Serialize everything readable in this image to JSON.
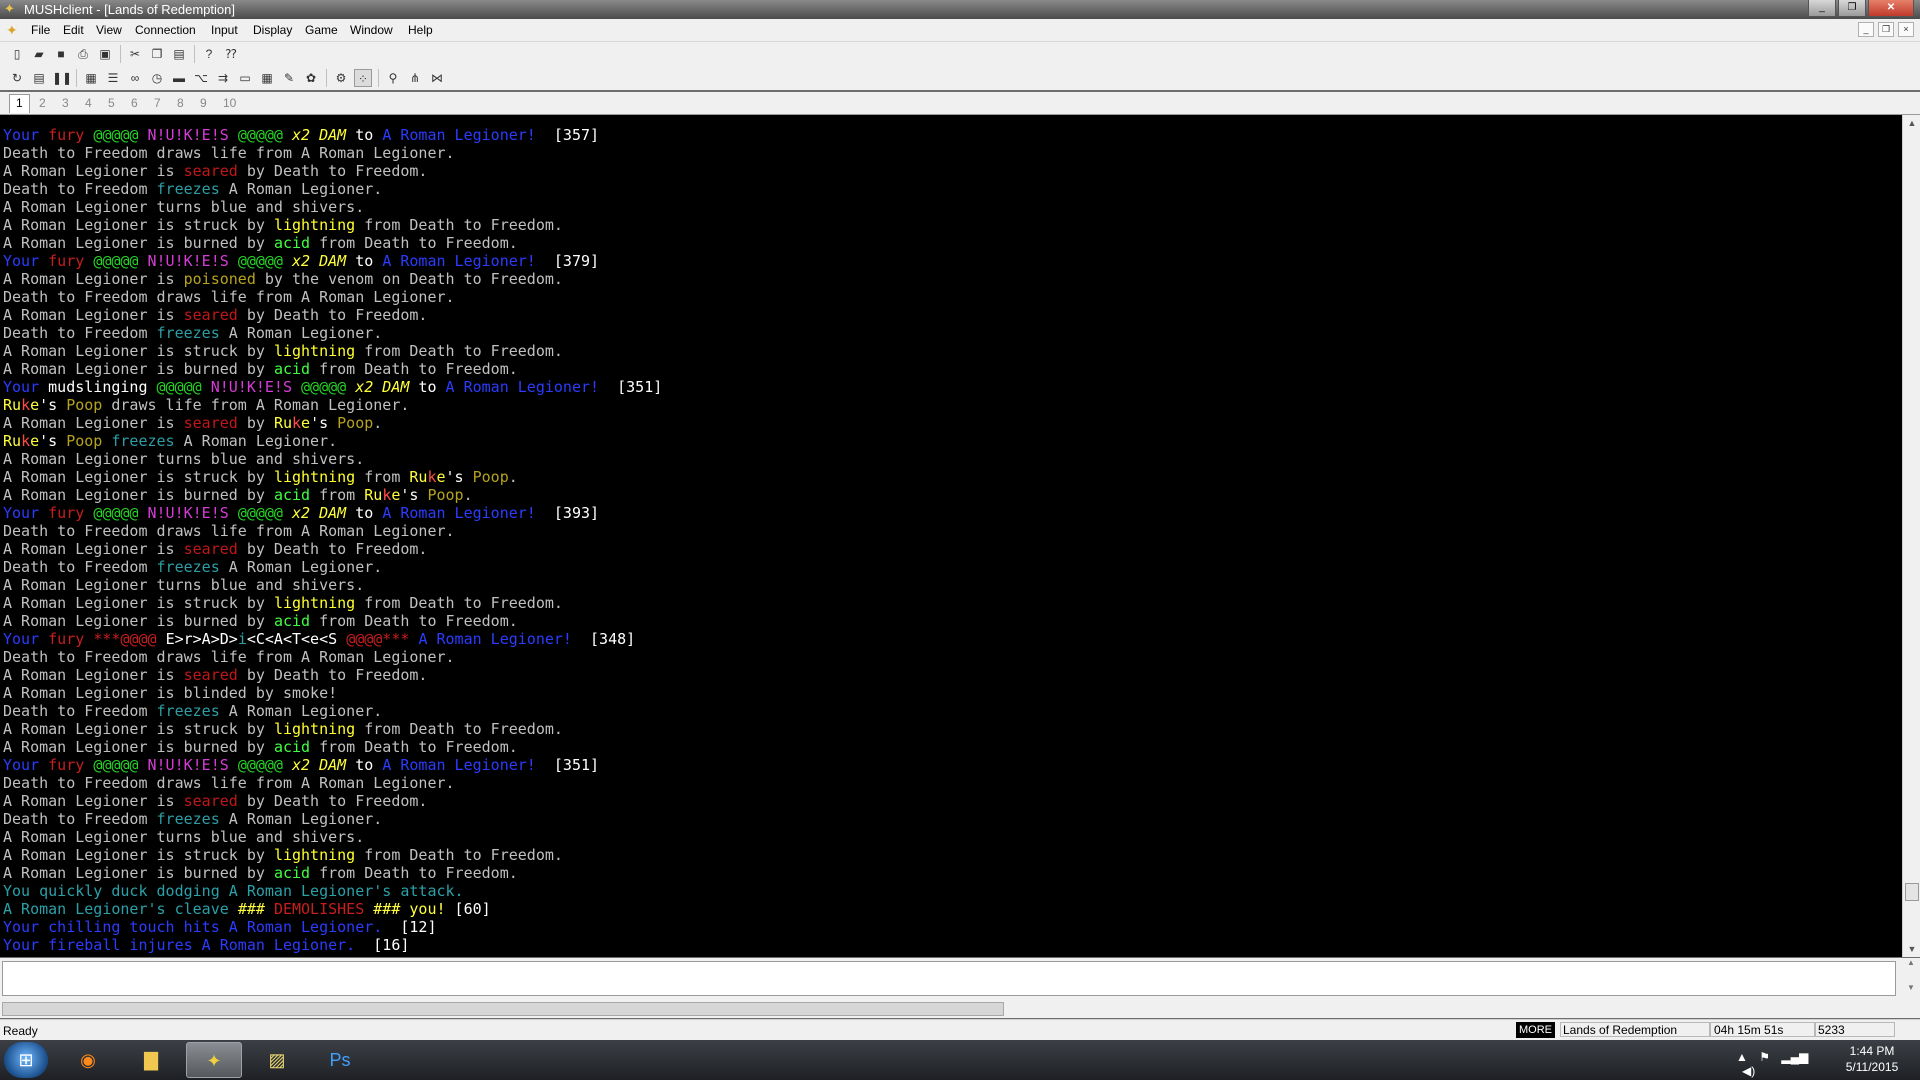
{
  "window": {
    "title": "MUSHclient - [Lands of Redemption]",
    "controls": [
      "_",
      "❐",
      "✕"
    ],
    "mdi_controls": [
      "_",
      "❐",
      "×"
    ]
  },
  "menu": [
    "File",
    "Edit",
    "View",
    "Connection",
    "Input",
    "Display",
    "Game",
    "Window",
    "Help"
  ],
  "toolbar1": [
    {
      "name": "new-icon",
      "glyph": "▯"
    },
    {
      "name": "open-icon",
      "glyph": "▰"
    },
    {
      "name": "save-icon",
      "glyph": "■"
    },
    {
      "name": "print-icon",
      "glyph": "⎙"
    },
    {
      "name": "print-preview-icon",
      "glyph": "▣"
    },
    {
      "name": "cut-icon",
      "glyph": "✂"
    },
    {
      "name": "copy-icon",
      "glyph": "❐"
    },
    {
      "name": "paste-icon",
      "glyph": "▤"
    },
    {
      "name": "help-icon",
      "glyph": "?"
    },
    {
      "name": "context-help-icon",
      "glyph": "⁇"
    }
  ],
  "toolbar2": [
    {
      "name": "reconnect-icon",
      "glyph": "↻"
    },
    {
      "name": "log-icon",
      "glyph": "▤"
    },
    {
      "name": "pause-icon",
      "glyph": "❚❚"
    },
    {
      "name": "world-config-icon",
      "glyph": "▦"
    },
    {
      "name": "list-icon",
      "glyph": "☰"
    },
    {
      "name": "macro-icon",
      "glyph": "∞"
    },
    {
      "name": "timer-icon",
      "glyph": "◷"
    },
    {
      "name": "screen-icon",
      "glyph": "▬"
    },
    {
      "name": "trigger-icon",
      "glyph": "⌥"
    },
    {
      "name": "alias-icon",
      "glyph": "⇉"
    },
    {
      "name": "window-icon",
      "glyph": "▭"
    },
    {
      "name": "table-icon",
      "glyph": "▦"
    },
    {
      "name": "notepad-icon",
      "glyph": "✎"
    },
    {
      "name": "scripts-icon",
      "glyph": "✿"
    },
    {
      "name": "plugins-icon",
      "glyph": "⚙"
    },
    {
      "name": "speedwalk-icon",
      "glyph": "⁘"
    },
    {
      "name": "find-icon",
      "glyph": "⚲"
    },
    {
      "name": "mapper-icon",
      "glyph": "⋔"
    },
    {
      "name": "chat-icon",
      "glyph": "⋈"
    }
  ],
  "world_tabs": [
    "1",
    "2",
    "3",
    "4",
    "5",
    "6",
    "7",
    "8",
    "9",
    "10"
  ],
  "colors": {
    "gray": "#c0c0c0",
    "blue": "#2b3cff",
    "red": "#c81e1e",
    "green": "#26d426",
    "magenta": "#d63cd6",
    "yellow": "#ffff3c",
    "cyan": "#2aa0a8",
    "lightred": "#ff4a4a",
    "olive": "#b5a31c",
    "white": "#ffffff",
    "acid": "#40ff40",
    "lightning": "#ffff30",
    "seared": "#c01818",
    "freeze": "#2e9ea6"
  },
  "output_lines": [
    [
      [
        "Your ",
        "blue"
      ],
      [
        "fury ",
        "red"
      ],
      [
        "@@@@@ ",
        "green"
      ],
      [
        "N!U!K!E!S ",
        "magenta"
      ],
      [
        "@@@@@ ",
        "green"
      ],
      [
        "x2 DAM ",
        "yellow"
      ],
      [
        "to ",
        "white"
      ],
      [
        "A Roman Legioner!",
        "blue"
      ],
      [
        "  [357]",
        "white"
      ]
    ],
    [
      [
        "Death to Freedom draws life from A Roman Legioner.",
        "gray"
      ]
    ],
    [
      [
        "A Roman Legioner is ",
        "gray"
      ],
      [
        "seared",
        "seared"
      ],
      [
        " by Death to Freedom.",
        "gray"
      ]
    ],
    [
      [
        "Death to Freedom ",
        "gray"
      ],
      [
        "freezes",
        "freeze"
      ],
      [
        " A Roman Legioner.",
        "gray"
      ]
    ],
    [
      [
        "A Roman Legioner turns blue and shivers.",
        "gray"
      ]
    ],
    [
      [
        "A Roman Legioner is struck by ",
        "gray"
      ],
      [
        "lightning",
        "lightning"
      ],
      [
        " from Death to Freedom.",
        "gray"
      ]
    ],
    [
      [
        "A Roman Legioner is burned by ",
        "gray"
      ],
      [
        "acid",
        "acid"
      ],
      [
        " from Death to Freedom.",
        "gray"
      ]
    ],
    [
      [
        "Your ",
        "blue"
      ],
      [
        "fury ",
        "red"
      ],
      [
        "@@@@@ ",
        "green"
      ],
      [
        "N!U!K!E!S ",
        "magenta"
      ],
      [
        "@@@@@ ",
        "green"
      ],
      [
        "x2 DAM ",
        "yellow"
      ],
      [
        "to ",
        "white"
      ],
      [
        "A Roman Legioner!",
        "blue"
      ],
      [
        "  [379]",
        "white"
      ]
    ],
    [
      [
        "A Roman Legioner is ",
        "gray"
      ],
      [
        "poisoned",
        "olive"
      ],
      [
        " by the venom on Death to Freedom.",
        "gray"
      ]
    ],
    [
      [
        "Death to Freedom draws life from A Roman Legioner.",
        "gray"
      ]
    ],
    [
      [
        "A Roman Legioner is ",
        "gray"
      ],
      [
        "seared",
        "seared"
      ],
      [
        " by Death to Freedom.",
        "gray"
      ]
    ],
    [
      [
        "Death to Freedom ",
        "gray"
      ],
      [
        "freezes",
        "freeze"
      ],
      [
        " A Roman Legioner.",
        "gray"
      ]
    ],
    [
      [
        "A Roman Legioner is struck by ",
        "gray"
      ],
      [
        "lightning",
        "lightning"
      ],
      [
        " from Death to Freedom.",
        "gray"
      ]
    ],
    [
      [
        "A Roman Legioner is burned by ",
        "gray"
      ],
      [
        "acid",
        "acid"
      ],
      [
        " from Death to Freedom.",
        "gray"
      ]
    ],
    [
      [
        "Your ",
        "blue"
      ],
      [
        "mudslinging ",
        "white"
      ],
      [
        "@@@@@ ",
        "green"
      ],
      [
        "N!U!K!E!S ",
        "magenta"
      ],
      [
        "@@@@@ ",
        "green"
      ],
      [
        "x2 DAM ",
        "yellow"
      ],
      [
        "to ",
        "white"
      ],
      [
        "A Roman Legioner!",
        "blue"
      ],
      [
        "  [351]",
        "white"
      ]
    ],
    [
      [
        "Ru",
        "yellow"
      ],
      [
        "k",
        "lightred"
      ],
      [
        "e",
        "yellow"
      ],
      [
        "'s ",
        "white"
      ],
      [
        "Poop",
        "olive"
      ],
      [
        " draws life from A Roman Legioner.",
        "gray"
      ]
    ],
    [
      [
        "A Roman Legioner is ",
        "gray"
      ],
      [
        "seared",
        "seared"
      ],
      [
        " by ",
        "gray"
      ],
      [
        "Ru",
        "yellow"
      ],
      [
        "k",
        "lightred"
      ],
      [
        "e",
        "yellow"
      ],
      [
        "'s ",
        "white"
      ],
      [
        "Poop",
        "olive"
      ],
      [
        ".",
        "gray"
      ]
    ],
    [
      [
        "Ru",
        "yellow"
      ],
      [
        "k",
        "lightred"
      ],
      [
        "e",
        "yellow"
      ],
      [
        "'s ",
        "white"
      ],
      [
        "Poop ",
        "olive"
      ],
      [
        "freezes",
        "freeze"
      ],
      [
        " A Roman Legioner.",
        "gray"
      ]
    ],
    [
      [
        "A Roman Legioner turns blue and shivers.",
        "gray"
      ]
    ],
    [
      [
        "A Roman Legioner is struck by ",
        "gray"
      ],
      [
        "lightning",
        "lightning"
      ],
      [
        " from ",
        "gray"
      ],
      [
        "Ru",
        "yellow"
      ],
      [
        "k",
        "lightred"
      ],
      [
        "e",
        "yellow"
      ],
      [
        "'s ",
        "white"
      ],
      [
        "Poop",
        "olive"
      ],
      [
        ".",
        "gray"
      ]
    ],
    [
      [
        "A Roman Legioner is burned by ",
        "gray"
      ],
      [
        "acid",
        "acid"
      ],
      [
        " from ",
        "gray"
      ],
      [
        "Ru",
        "yellow"
      ],
      [
        "k",
        "lightred"
      ],
      [
        "e",
        "yellow"
      ],
      [
        "'s ",
        "white"
      ],
      [
        "Poop",
        "olive"
      ],
      [
        ".",
        "gray"
      ]
    ],
    [
      [
        "Your ",
        "blue"
      ],
      [
        "fury ",
        "red"
      ],
      [
        "@@@@@ ",
        "green"
      ],
      [
        "N!U!K!E!S ",
        "magenta"
      ],
      [
        "@@@@@ ",
        "green"
      ],
      [
        "x2 DAM ",
        "yellow"
      ],
      [
        "to ",
        "white"
      ],
      [
        "A Roman Legioner!",
        "blue"
      ],
      [
        "  [393]",
        "white"
      ]
    ],
    [
      [
        "Death to Freedom draws life from A Roman Legioner.",
        "gray"
      ]
    ],
    [
      [
        "A Roman Legioner is ",
        "gray"
      ],
      [
        "seared",
        "seared"
      ],
      [
        " by Death to Freedom.",
        "gray"
      ]
    ],
    [
      [
        "Death to Freedom ",
        "gray"
      ],
      [
        "freezes",
        "freeze"
      ],
      [
        " A Roman Legioner.",
        "gray"
      ]
    ],
    [
      [
        "A Roman Legioner turns blue and shivers.",
        "gray"
      ]
    ],
    [
      [
        "A Roman Legioner is struck by ",
        "gray"
      ],
      [
        "lightning",
        "lightning"
      ],
      [
        " from Death to Freedom.",
        "gray"
      ]
    ],
    [
      [
        "A Roman Legioner is burned by ",
        "gray"
      ],
      [
        "acid",
        "acid"
      ],
      [
        " from Death to Freedom.",
        "gray"
      ]
    ],
    [
      [
        "Your ",
        "blue"
      ],
      [
        "fury ",
        "red"
      ],
      [
        "***@@@@ ",
        "red"
      ],
      [
        "E>r>A>D>",
        "white"
      ],
      [
        "i",
        "cyan"
      ],
      [
        "<C<A<T<e<S ",
        "white"
      ],
      [
        "@@@@*** ",
        "red"
      ],
      [
        "A Roman Legioner!",
        "blue"
      ],
      [
        "  [348]",
        "white"
      ]
    ],
    [
      [
        "Death to Freedom draws life from A Roman Legioner.",
        "gray"
      ]
    ],
    [
      [
        "A Roman Legioner is ",
        "gray"
      ],
      [
        "seared",
        "seared"
      ],
      [
        " by Death to Freedom.",
        "gray"
      ]
    ],
    [
      [
        "A Roman Legioner is blinded by smoke!",
        "gray"
      ]
    ],
    [
      [
        "Death to Freedom ",
        "gray"
      ],
      [
        "freezes",
        "freeze"
      ],
      [
        " A Roman Legioner.",
        "gray"
      ]
    ],
    [
      [
        "A Roman Legioner is struck by ",
        "gray"
      ],
      [
        "lightning",
        "lightning"
      ],
      [
        " from Death to Freedom.",
        "gray"
      ]
    ],
    [
      [
        "A Roman Legioner is burned by ",
        "gray"
      ],
      [
        "acid",
        "acid"
      ],
      [
        " from Death to Freedom.",
        "gray"
      ]
    ],
    [
      [
        "Your ",
        "blue"
      ],
      [
        "fury ",
        "red"
      ],
      [
        "@@@@@ ",
        "green"
      ],
      [
        "N!U!K!E!S ",
        "magenta"
      ],
      [
        "@@@@@ ",
        "green"
      ],
      [
        "x2 DAM ",
        "yellow"
      ],
      [
        "to ",
        "white"
      ],
      [
        "A Roman Legioner!",
        "blue"
      ],
      [
        "  [351]",
        "white"
      ]
    ],
    [
      [
        "Death to Freedom draws life from A Roman Legioner.",
        "gray"
      ]
    ],
    [
      [
        "A Roman Legioner is ",
        "gray"
      ],
      [
        "seared",
        "seared"
      ],
      [
        " by Death to Freedom.",
        "gray"
      ]
    ],
    [
      [
        "Death to Freedom ",
        "gray"
      ],
      [
        "freezes",
        "freeze"
      ],
      [
        " A Roman Legioner.",
        "gray"
      ]
    ],
    [
      [
        "A Roman Legioner turns blue and shivers.",
        "gray"
      ]
    ],
    [
      [
        "A Roman Legioner is struck by ",
        "gray"
      ],
      [
        "lightning",
        "lightning"
      ],
      [
        " from Death to Freedom.",
        "gray"
      ]
    ],
    [
      [
        "A Roman Legioner is burned by ",
        "gray"
      ],
      [
        "acid",
        "acid"
      ],
      [
        " from Death to Freedom.",
        "gray"
      ]
    ],
    [
      [
        "You quickly duck dodging A Roman Legioner's attack.",
        "cyan"
      ]
    ],
    [
      [
        "A Roman Legioner's cleave ",
        "cyan"
      ],
      [
        "### ",
        "yellow"
      ],
      [
        "DEMOLISHES ",
        "red"
      ],
      [
        "### ",
        "yellow"
      ],
      [
        "you!",
        "yellow"
      ],
      [
        " [60]",
        "white"
      ]
    ],
    [
      [
        "Your chilling touch hits A Roman Legioner.",
        "blue"
      ],
      [
        "  [12]",
        "white"
      ]
    ],
    [
      [
        "Your fireball injures A Roman Legioner.",
        "blue"
      ],
      [
        "  [16]",
        "white"
      ]
    ]
  ],
  "command": {
    "value": "",
    "placeholder": ""
  },
  "status": {
    "ready": "Ready",
    "more": "MORE",
    "world": "Lands of Redemption",
    "time": "04h 15m 51s",
    "count": "5233"
  },
  "taskbar": {
    "apps": [
      {
        "name": "firefox-icon",
        "glyph": "◉",
        "color": "#ff8a1c"
      },
      {
        "name": "explorer-icon",
        "glyph": "▇",
        "color": "#f0c850"
      },
      {
        "name": "mushclient-icon",
        "glyph": "✦",
        "color": "#f0d040",
        "active": true
      },
      {
        "name": "notes-icon",
        "glyph": "▨",
        "color": "#e8d870"
      },
      {
        "name": "photoshop-icon",
        "glyph": "Ps",
        "color": "#3fa0ff"
      }
    ],
    "time": "1:44 PM",
    "date": "5/11/2015"
  }
}
